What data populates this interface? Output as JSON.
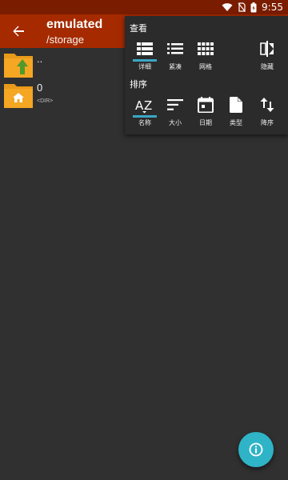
{
  "status": {
    "time": "9:55"
  },
  "header": {
    "title": "emulated",
    "subtitle": "/storage"
  },
  "files": [
    {
      "name": "..",
      "meta": ""
    },
    {
      "name": "0",
      "meta": "<DIR>"
    }
  ],
  "menu": {
    "view_label": "查看",
    "view_options": [
      {
        "label": "详细",
        "icon": "list-detail-icon",
        "selected": true
      },
      {
        "label": "紧凑",
        "icon": "list-compact-icon",
        "selected": false
      },
      {
        "label": "网格",
        "icon": "grid-icon",
        "selected": false
      },
      {
        "label": "隐藏",
        "icon": "hide-icon",
        "selected": false
      }
    ],
    "sort_label": "排序",
    "sort_options": [
      {
        "label": "名称",
        "icon": "sort-az-icon",
        "selected": true
      },
      {
        "label": "大小",
        "icon": "sort-size-icon",
        "selected": false
      },
      {
        "label": "日期",
        "icon": "calendar-icon",
        "selected": false
      },
      {
        "label": "类型",
        "icon": "file-type-icon",
        "selected": false
      },
      {
        "label": "降序",
        "icon": "sort-desc-icon",
        "selected": false
      }
    ]
  },
  "colors": {
    "statusbar": "#7a1c00",
    "appbar": "#a52a00",
    "accent": "#3ba6c7",
    "fab": "#2fb3c7",
    "folder": "#f5a623"
  }
}
